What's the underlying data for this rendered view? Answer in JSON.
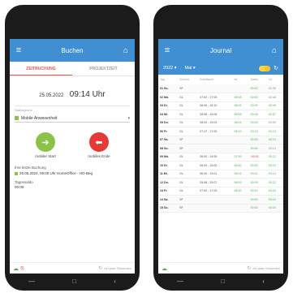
{
  "left": {
    "appbar": {
      "title": "Buchen",
      "menu_icon": "≡",
      "home_icon": "⌂"
    },
    "tabs": [
      "ZEITBUCHUNG",
      "PROJEKTZEIT"
    ],
    "date": "25.05.2022",
    "time": "09:14 Uhr",
    "status_label": "Statusgrund",
    "status_value": "Mobile Anwesenheit",
    "actions": {
      "start_label": "mobiler Start",
      "end_label": "mobiles Ende"
    },
    "last_booking_title": "Ihre letzte Buchung",
    "last_booking_text": "25.05.2022, 09:00 Uhr HomeOffice - HO-Beg",
    "saldo_label": "Tagessaldo",
    "saldo_value": "00:00",
    "sync_text": "ein paar Sekunden"
  },
  "right": {
    "appbar": {
      "title": "Journal",
      "menu_icon": "≡",
      "home_icon": "⌂"
    },
    "year": "2022 ▾",
    "month": "Mai ▾",
    "columns": [
      "Tag",
      "Schicht",
      "Arbeitszeit",
      "Ist",
      "Saldo",
      "Inf."
    ],
    "rows": [
      {
        "day": "01 So.",
        "shift": "SF",
        "time": "",
        "ist": "",
        "saldo": "00:00",
        "inf": "02:39"
      },
      {
        "day": "02 Mo.",
        "shift": "GL",
        "time": "07:52 - 17:00",
        "ist": "08:08",
        "saldo": "00:00",
        "inf": "02:48"
      },
      {
        "day": "03 Di.",
        "shift": "GL",
        "time": "06:06 - 15:10",
        "ist": "08:02",
        "saldo": "00:02",
        "inf": "02:49"
      },
      {
        "day": "04 Mi.",
        "shift": "GL",
        "time": "05:58 - 15:06",
        "ist": "08:08",
        "saldo": "00:08",
        "inf": "02:57"
      },
      {
        "day": "05 Do.",
        "shift": "GL",
        "time": "06:00 - 15:03",
        "ist": "08:03",
        "saldo": "00:03",
        "inf": "03:00"
      },
      {
        "day": "06 Fr.",
        "shift": "GL",
        "time": "07:47 - 17:00",
        "ist": "08:13",
        "saldo": "00:13",
        "inf": "03:13"
      },
      {
        "day": "07 Sa.",
        "shift": "SF",
        "time": "",
        "ist": "",
        "saldo": "00:00",
        "inf": "03:13"
      },
      {
        "day": "08 So.",
        "shift": "SF",
        "time": "",
        "ist": "",
        "saldo": "00:00",
        "inf": "03:13"
      },
      {
        "day": "09 Mo.",
        "shift": "GL",
        "time": "06:00 - 14:59",
        "ist": "07:59",
        "saldo": "-00:01",
        "inf": "03:12"
      },
      {
        "day": "10 Di.",
        "shift": "GL",
        "time": "06:00 - 15:00",
        "ist": "08:00",
        "saldo": "00:00",
        "inf": "03:12"
      },
      {
        "day": "11 Mi.",
        "shift": "GL",
        "time": "06:00 - 15:01",
        "ist": "08:01",
        "saldo": "00:01",
        "inf": "03:13"
      },
      {
        "day": "12 Do.",
        "shift": "GL",
        "time": "05:58 - 15:07",
        "ist": "08:09",
        "saldo": "00:09",
        "inf": "03:22"
      },
      {
        "day": "13 Fr.",
        "shift": "GL",
        "time": "07:50 - 17:00",
        "ist": "08:10",
        "saldo": "00:10",
        "inf": "03:24"
      },
      {
        "day": "14 Sa.",
        "shift": "SF",
        "time": "",
        "ist": "",
        "saldo": "00:00",
        "inf": "03:24"
      },
      {
        "day": "15 So.",
        "shift": "SF",
        "time": "",
        "ist": "",
        "saldo": "00:00",
        "inf": "03:24"
      }
    ],
    "sync_text": "ein paar Sekunden"
  },
  "nav": {
    "back": "◁",
    "home": "□",
    "recent": "‹"
  },
  "colors": {
    "accent": "#3f8fd2",
    "green": "#8bc34a",
    "red": "#e53935",
    "active_tab": "#e05555"
  }
}
